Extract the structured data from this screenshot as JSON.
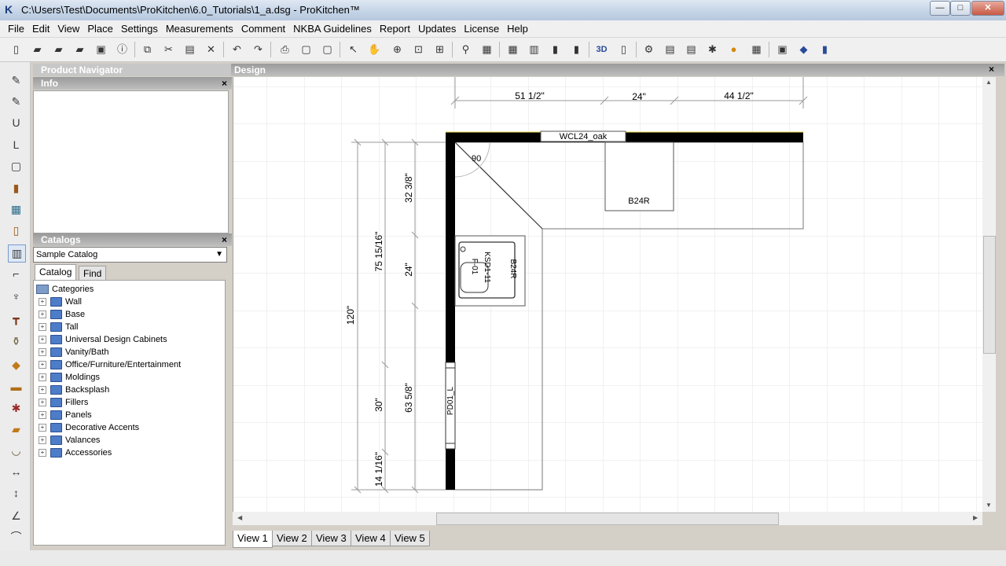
{
  "window": {
    "title": "C:\\Users\\Test\\Documents\\ProKitchen\\6.0_Tutorials\\1_a.dsg - ProKitchen™",
    "min": "—",
    "max": "□",
    "close": "✕"
  },
  "menu": [
    "File",
    "Edit",
    "View",
    "Place",
    "Settings",
    "Measurements",
    "Comment",
    "NKBA Guidelines",
    "Report",
    "Updates",
    "License",
    "Help"
  ],
  "panels": {
    "navigator": "Product Navigator",
    "info": "Info",
    "catalogs": "Catalogs",
    "close_glyph": "×"
  },
  "catalog_select": "Sample Catalog",
  "catalog_tabs": [
    "Catalog",
    "Find"
  ],
  "tree": {
    "root": "Categories",
    "items": [
      "Wall",
      "Base",
      "Tall",
      "Universal Design Cabinets",
      "Vanity/Bath",
      "Office/Furniture/Entertainment",
      "Moldings",
      "Backsplash",
      "Fillers",
      "Panels",
      "Decorative Accents",
      "Valances",
      "Accessories"
    ]
  },
  "design": {
    "title": "Design",
    "close": "×",
    "labels": {
      "dim_top_1": "51 1/2\"",
      "dim_top_2": "24\"",
      "dim_top_3": "44 1/2\"",
      "wall_cab": "WCL24_oak",
      "base_cab": "B24R",
      "angle": "90",
      "dim_left_total": "120\"",
      "dim_left_a": "75 15/16\"",
      "dim_left_b": "30\"",
      "dim_left_c": "14 1/16\"",
      "dim_left_d": "32 3/8\"",
      "dim_left_e": "24\"",
      "dim_left_f": "63 5/8\"",
      "sink_a": "F-01",
      "sink_b": "KSD1-11",
      "sink_cab": "B24R",
      "door": "PD01_L"
    }
  },
  "view_tabs": [
    "View 1",
    "View 2",
    "View 3",
    "View 4",
    "View 5"
  ],
  "toolbar_icons": [
    "new-icon",
    "open-icon",
    "open-folder-icon",
    "open-alt-icon",
    "save-icon",
    "info-icon",
    "copy-icon",
    "cut-icon",
    "paste-icon",
    "delete-icon",
    "undo-icon",
    "redo-icon",
    "print-icon",
    "print-preview-icon",
    "page-setup-icon",
    "select-icon",
    "pan-icon",
    "zoom-in-icon",
    "zoom-window-icon",
    "zoom-fit-icon",
    "find-icon",
    "properties-icon",
    "grid-icon",
    "elevation-icon",
    "cabinet-icon",
    "catalog-icon",
    "3d-icon",
    "plan-view-icon",
    "render-icon",
    "report-icon",
    "list-icon",
    "settings-icon",
    "material-icon",
    "quote-icon",
    "export-icon",
    "help-icon",
    "book-icon",
    "manual-icon"
  ],
  "left_tools": [
    "wall-draw-icon",
    "wall-edit-icon",
    "u-shape-icon",
    "l-shape-icon",
    "room-icon",
    "door-icon",
    "window-icon",
    "tall-door-icon",
    "cabinet-tool-icon",
    "faucet-icon",
    "lighting-icon",
    "table-icon",
    "vase-icon",
    "box-icon",
    "molding-icon",
    "tile-icon",
    "countertop-icon",
    "bowl-icon",
    "dimension-h-icon",
    "dimension-v-icon",
    "angle-dimension-icon",
    "arc-icon",
    "arrow-up-icon"
  ]
}
